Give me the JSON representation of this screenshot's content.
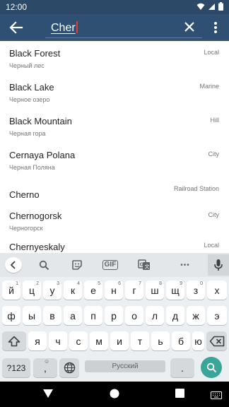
{
  "status": {
    "time": "12:00"
  },
  "search": {
    "query": "Cher"
  },
  "results": [
    {
      "name": "Black Forest",
      "sub": "Черный лес",
      "type": "Local"
    },
    {
      "name": "Black Lake",
      "sub": "Черное озеро",
      "type": "Marine"
    },
    {
      "name": "Black Mountain",
      "sub": "Черная гора",
      "type": "Hill"
    },
    {
      "name": "Cernaya Polana",
      "sub": "Черная Поляна",
      "type": "City"
    },
    {
      "name": "Cherno",
      "sub": "",
      "type": "Railroad Station"
    },
    {
      "name": "Chernogorsk",
      "sub": "Черногорск",
      "type": "City"
    },
    {
      "name": "Chernyeskaly",
      "sub": "",
      "type": "Local"
    }
  ],
  "keyboard": {
    "toolbar": {
      "gif_label": "GIF",
      "more_label": "•••"
    },
    "row1": [
      {
        "char": "й",
        "hint": "1"
      },
      {
        "char": "ц",
        "hint": "2"
      },
      {
        "char": "у",
        "hint": "3"
      },
      {
        "char": "к",
        "hint": "4"
      },
      {
        "char": "е",
        "hint": "5"
      },
      {
        "char": "н",
        "hint": "6"
      },
      {
        "char": "г",
        "hint": "7"
      },
      {
        "char": "ш",
        "hint": "8"
      },
      {
        "char": "щ",
        "hint": "9"
      },
      {
        "char": "з",
        "hint": "0"
      },
      {
        "char": "х",
        "hint": ""
      }
    ],
    "row2": [
      "ф",
      "ы",
      "в",
      "а",
      "п",
      "р",
      "о",
      "л",
      "д",
      "ж",
      "э"
    ],
    "row3": [
      "я",
      "ч",
      "с",
      "м",
      "и",
      "т",
      "ь",
      "б",
      "ю"
    ],
    "row4": {
      "numbers_label": "?123",
      "comma": ",",
      "comma_hint": "☺",
      "space_label": "Русский",
      "period": "."
    }
  },
  "colors": {
    "app_bar": "#2f5072",
    "status_bar": "#2c4a68",
    "accent": "#3aa59a",
    "cursor": "#e53935"
  }
}
